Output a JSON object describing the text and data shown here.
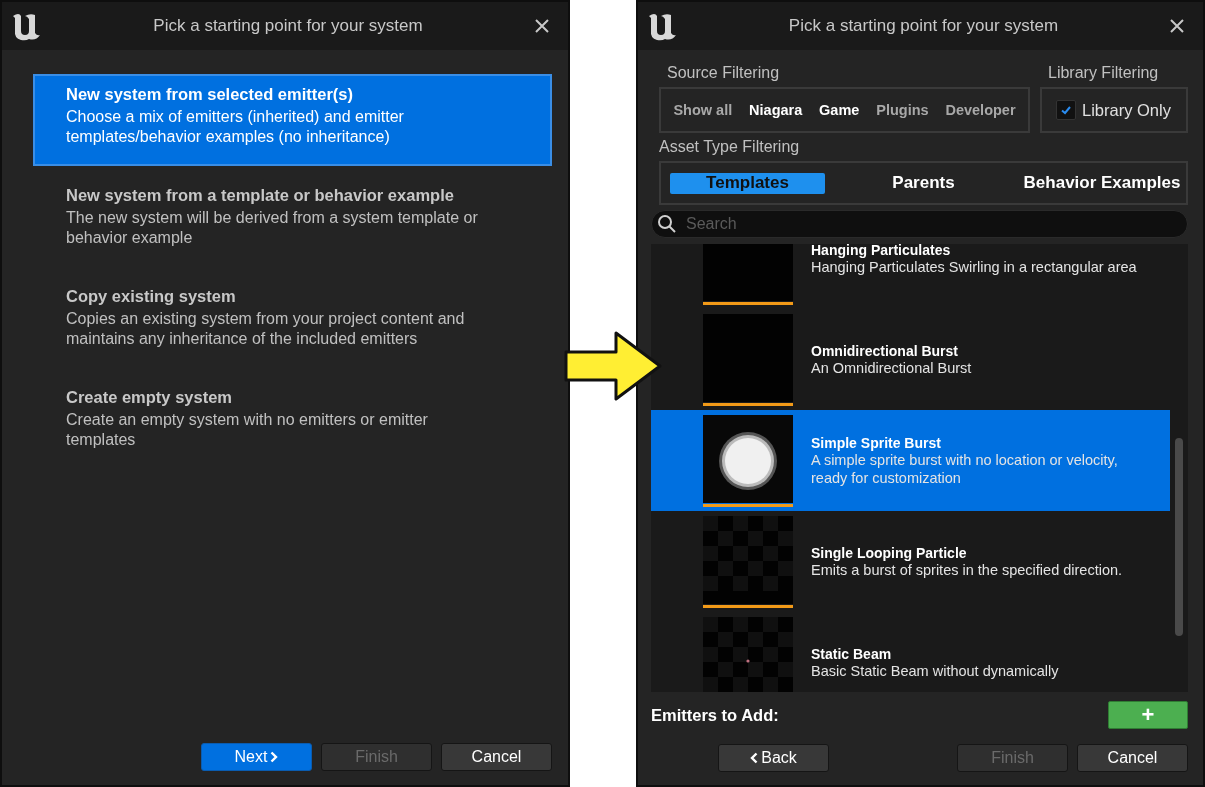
{
  "left_window": {
    "title": "Pick a starting point for your system",
    "options": [
      {
        "title": "New system from selected emitter(s)",
        "description": "Choose a mix of emitters (inherited) and emitter templates/behavior examples (no inheritance)",
        "selected": true
      },
      {
        "title": "New system from a template or behavior example",
        "description": "The new system will be derived from a system template or behavior example",
        "selected": false
      },
      {
        "title": "Copy existing system",
        "description": "Copies an existing system from your project content and maintains any inheritance of the included emitters",
        "selected": false
      },
      {
        "title": "Create empty system",
        "description": "Create an empty system with no emitters or emitter templates",
        "selected": false
      }
    ],
    "buttons": [
      {
        "label": "Next",
        "kind": "next",
        "disabled": false
      },
      {
        "label": "Finish",
        "kind": "plain",
        "disabled": true
      },
      {
        "label": "Cancel",
        "kind": "plain",
        "disabled": false
      }
    ]
  },
  "right_window": {
    "title": "Pick a starting point for your system",
    "source_filtering": {
      "label": "Source Filtering",
      "chips": [
        {
          "label": "Show all",
          "selected": false
        },
        {
          "label": "Niagara",
          "selected": true
        },
        {
          "label": "Game",
          "selected": true
        },
        {
          "label": "Plugins",
          "selected": false
        },
        {
          "label": "Developer",
          "selected": false
        }
      ]
    },
    "library_filtering": {
      "label": "Library Filtering",
      "checkbox": {
        "label": "Library Only",
        "checked": true
      }
    },
    "asset_type_filtering": {
      "label": "Asset Type Filtering",
      "tabs": [
        {
          "label": "Templates",
          "selected": true
        },
        {
          "label": "Parents",
          "selected": false
        },
        {
          "label": "Behavior Examples",
          "selected": false
        }
      ]
    },
    "search": {
      "placeholder": "Search"
    },
    "assets": [
      {
        "name": "Hanging Particulates",
        "description": "Hanging Particulates Swirling in a rectangular area",
        "kind": "dark",
        "selected": false
      },
      {
        "name": "Omnidirectional Burst",
        "description": "An Omnidirectional Burst",
        "kind": "dark",
        "selected": false
      },
      {
        "name": "Simple Sprite Burst",
        "description": "A simple sprite burst with no location or velocity, ready for customization",
        "kind": "sprite",
        "selected": true
      },
      {
        "name": "Single Looping Particle",
        "description": "Emits a burst of sprites in the specified direction.",
        "kind": "checker",
        "selected": false
      },
      {
        "name": "Static Beam",
        "description": "Basic Static Beam without dynamically",
        "kind": "checker_dot",
        "selected": false
      }
    ],
    "emitters_label": "Emitters to Add:",
    "add_button": {
      "label": "+"
    },
    "buttons": [
      {
        "label": "Back",
        "kind": "back",
        "disabled": false
      },
      {
        "label": "Finish",
        "kind": "plain",
        "disabled": true
      },
      {
        "label": "Cancel",
        "kind": "plain",
        "disabled": false
      }
    ]
  }
}
